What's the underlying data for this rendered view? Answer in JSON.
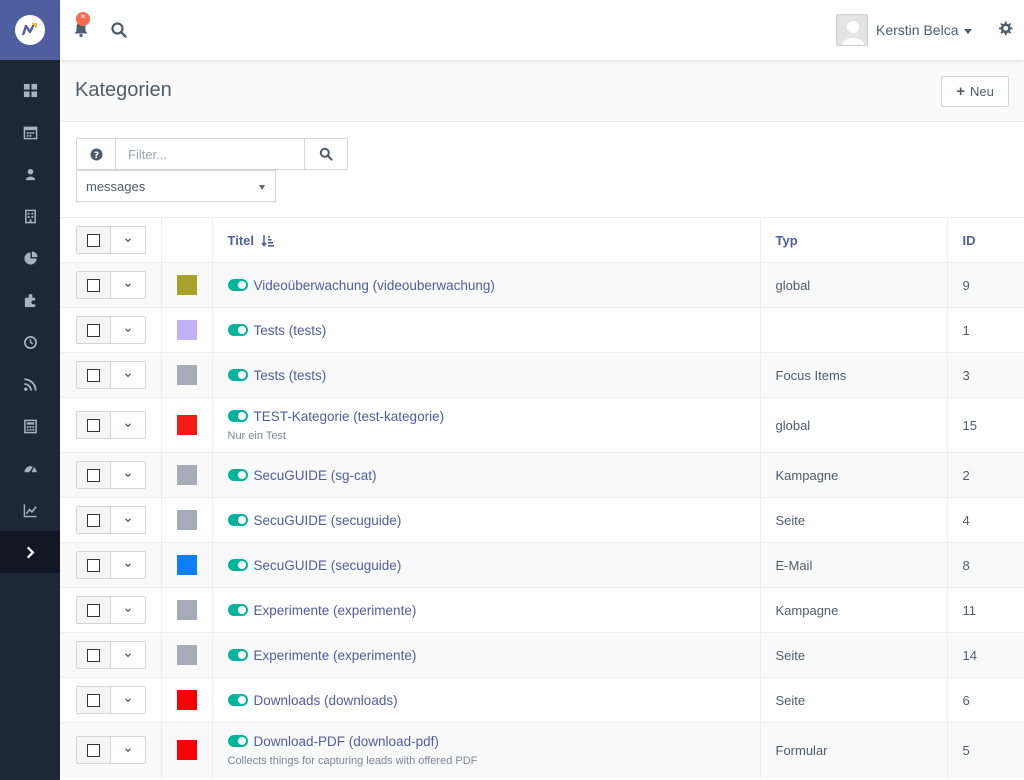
{
  "app": {
    "brand_colors": {
      "sidebar": "#1d2735",
      "logo_bg": "#4e5e9e",
      "accent": "#4e5e9e",
      "toggle_on": "#00b49c",
      "badge": "#f86b4f"
    }
  },
  "topbar": {
    "notification_badge": "*",
    "user_name": "Kerstin Belca"
  },
  "sidebar": {
    "items": [
      {
        "icon": "dashboard-icon"
      },
      {
        "icon": "calendar-icon"
      },
      {
        "icon": "contacts-icon"
      },
      {
        "icon": "companies-icon"
      },
      {
        "icon": "segments-icon"
      },
      {
        "icon": "components-icon"
      },
      {
        "icon": "campaigns-icon"
      },
      {
        "icon": "channels-icon"
      },
      {
        "icon": "points-icon"
      },
      {
        "icon": "stages-icon"
      },
      {
        "icon": "reports-icon"
      },
      {
        "icon": "expand-icon"
      }
    ]
  },
  "page": {
    "title": "Kategorien",
    "new_button": "Neu"
  },
  "filter": {
    "placeholder": "Filter...",
    "value": "",
    "bundle_selected": "messages"
  },
  "table": {
    "columns": {
      "title": "Titel",
      "type": "Typ",
      "id": "ID"
    },
    "rows": [
      {
        "color": "#a6a22a",
        "title": "Videoüberwachung (videouberwachung)",
        "description": "",
        "type": "global",
        "id": "9"
      },
      {
        "color": "#c1b1f8",
        "title": "Tests (tests)",
        "description": "",
        "type": "",
        "id": "1"
      },
      {
        "color": "#a5acb8",
        "title": "Tests (tests)",
        "description": "",
        "type": "Focus Items",
        "id": "3"
      },
      {
        "color": "#f41b17",
        "title": "TEST-Kategorie (test-kategorie)",
        "description": "Nur ein Test",
        "type": "global",
        "id": "15"
      },
      {
        "color": "#a5acb8",
        "title": "SecuGUIDE (sg-cat)",
        "description": "",
        "type": "Kampagne",
        "id": "2"
      },
      {
        "color": "#a5acb8",
        "title": "SecuGUIDE (secuguide)",
        "description": "",
        "type": "Seite",
        "id": "4"
      },
      {
        "color": "#0a7ff8",
        "title": "SecuGUIDE (secuguide)",
        "description": "",
        "type": "E-Mail",
        "id": "8"
      },
      {
        "color": "#a5acb8",
        "title": "Experimente (experimente)",
        "description": "",
        "type": "Kampagne",
        "id": "11"
      },
      {
        "color": "#a5acb8",
        "title": "Experimente (experimente)",
        "description": "",
        "type": "Seite",
        "id": "14"
      },
      {
        "color": "#f80005",
        "title": "Downloads (downloads)",
        "description": "",
        "type": "Seite",
        "id": "6"
      },
      {
        "color": "#f80005",
        "title": "Download-PDF (download-pdf)",
        "description": "Collects things for capturing leads with offered PDF",
        "type": "Formular",
        "id": "5"
      }
    ]
  }
}
